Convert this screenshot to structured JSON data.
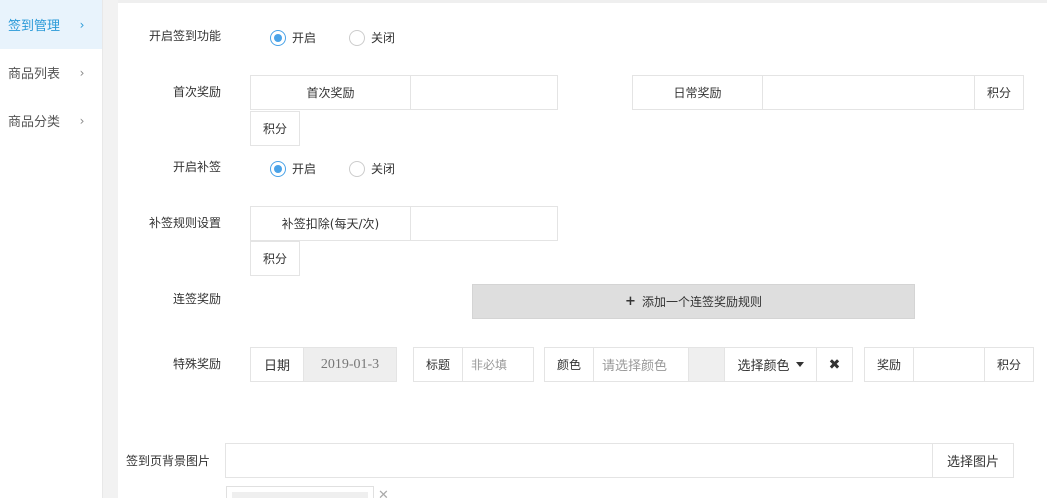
{
  "sidebar": {
    "items": [
      {
        "label": "签到管理",
        "icon": "chevron-right-icon"
      },
      {
        "label": "商品列表",
        "icon": "chevron-right-icon"
      },
      {
        "label": "商品分类",
        "icon": "chevron-right-icon"
      }
    ],
    "accent": "#2a9ad8"
  },
  "form": {
    "enable_signin": {
      "label": "开启签到功能",
      "options": [
        "开启",
        "关闭"
      ],
      "selected": "开启"
    },
    "first_reward": {
      "label": "首次奖励",
      "first_addon": "首次奖励",
      "first_value": "",
      "daily_addon": "日常奖励",
      "daily_value": "",
      "daily_unit": "积分",
      "first_unit": "积分"
    },
    "enable_makeup": {
      "label": "开启补签",
      "options": [
        "开启",
        "关闭"
      ],
      "selected": "开启"
    },
    "makeup_rule": {
      "label": "补签规则设置",
      "addon": "补签扣除(每天/次)",
      "value": "",
      "unit": "积分"
    },
    "continuous": {
      "label": "连签奖励",
      "add_button": "添加一个连签奖励规则"
    },
    "special": {
      "label": "特殊奖励",
      "date_addon": "日期",
      "date_value": "2019-01-3",
      "title_addon": "标题",
      "title_placeholder": "非必填",
      "color_addon": "颜色",
      "color_placeholder": "请选择颜色",
      "color_button": "选择颜色",
      "reward_addon": "奖励",
      "reward_value": "",
      "reward_unit": "积分"
    },
    "background": {
      "label": "签到页背景图片",
      "value": "",
      "button": "选择图片"
    }
  }
}
